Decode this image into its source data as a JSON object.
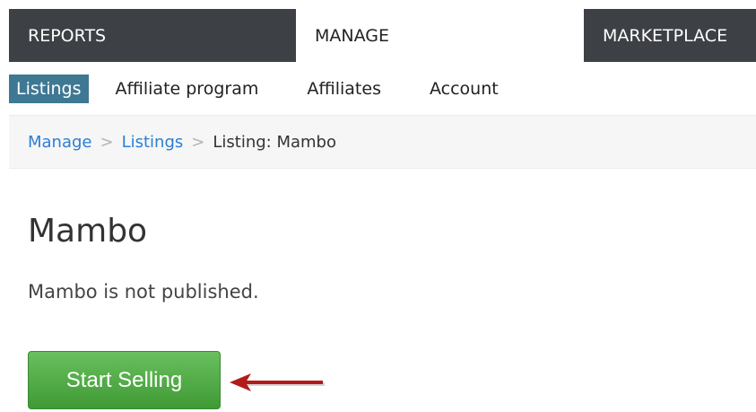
{
  "top_nav": {
    "tabs": [
      {
        "label": "REPORTS"
      },
      {
        "label": "MANAGE"
      },
      {
        "label": "MARKETPLACE"
      }
    ]
  },
  "sub_nav": {
    "items": [
      {
        "label": "Listings"
      },
      {
        "label": "Affiliate program"
      },
      {
        "label": "Affiliates"
      },
      {
        "label": "Account"
      }
    ]
  },
  "breadcrumb": {
    "items": [
      "Manage",
      "Listings",
      "Listing: Mambo"
    ],
    "separator": ">"
  },
  "page": {
    "title": "Mambo",
    "status": "Mambo is not published.",
    "start_button_label": "Start Selling"
  },
  "colors": {
    "top_nav_dark": "#3d4045",
    "active_subnav": "#3f7893",
    "link": "#2a7fd6",
    "button_green": "#4fae44",
    "arrow": "#b31b1b"
  }
}
